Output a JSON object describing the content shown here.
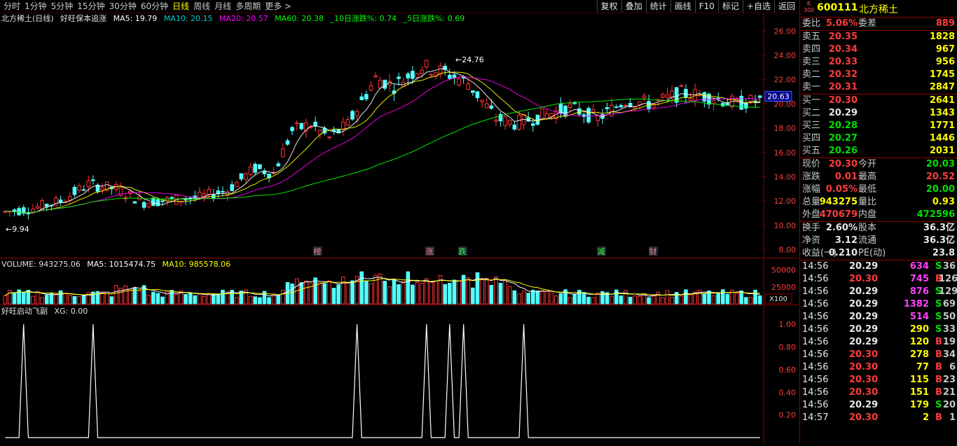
{
  "toolbar": {
    "periods": [
      "分时",
      "1分钟",
      "5分钟",
      "15分钟",
      "30分钟",
      "60分钟",
      "日线",
      "周线",
      "月线",
      "多周期",
      "更多 >"
    ],
    "active": "日线",
    "buttons": [
      "复权",
      "叠加",
      "统计",
      "画线",
      "F10",
      "标记",
      "+自选",
      "返回"
    ]
  },
  "main_legend": {
    "title": "北方稀土(日线)",
    "indicator": "好旺保本追涨",
    "ma5": "MA5: 19.79",
    "ma10": "MA10: 20.15",
    "ma20": "MA20: 20.57",
    "ma60": "MA60: 20.38",
    "chg10": "_10日涨跌%: 0.74",
    "chg5": "_5日涨跌%: 0.69"
  },
  "volume_legend": {
    "label": "VOLUME: 943275.06",
    "ma5": "MA5: 1015474.75",
    "ma10": "MA10: 985578.06"
  },
  "indicator_legend": {
    "label": "好旺启动飞副",
    "xg": "XG: 0.00"
  },
  "annotations": {
    "high": "24.76",
    "low": "9.94",
    "current": "20.63",
    "markers": [
      "榜",
      "涨",
      "跌",
      "减",
      "财"
    ],
    "vol_unit": "X100"
  },
  "chart_data": [
    {
      "type": "candlestick",
      "name": "main",
      "ylim": [
        7.4,
        27
      ],
      "y_ticks": [
        8.0,
        10.0,
        12.0,
        14.0,
        16.0,
        18.0,
        20.0,
        22.0,
        24.0,
        26.0
      ],
      "colors": {
        "up": "#ff3232",
        "down": "#54ffff",
        "ma5": "#ffffff",
        "ma10": "#ffff00",
        "ma20": "#ff00ff",
        "ma60": "#00ff00"
      }
    },
    {
      "type": "bar",
      "name": "volume",
      "ylim": [
        0,
        62000
      ],
      "y_ticks": [
        25000,
        50000
      ]
    },
    {
      "type": "line",
      "name": "indicator",
      "ylim": [
        0,
        1.1
      ],
      "y_ticks": [
        0.2,
        0.4,
        0.6,
        0.8,
        1.0
      ],
      "spike_index": [
        4,
        19,
        76,
        91,
        96,
        99,
        112
      ]
    }
  ],
  "quote": {
    "code": "600111",
    "name": "北方稀土",
    "r300": "R\n300",
    "weibi_lbl": "委比",
    "weibi": "5.06%",
    "weicha_lbl": "委差",
    "weicha": "889",
    "asks": [
      {
        "label": "卖五",
        "price": "20.35",
        "vol": "1828"
      },
      {
        "label": "卖四",
        "price": "20.34",
        "vol": "967"
      },
      {
        "label": "卖三",
        "price": "20.33",
        "vol": "956"
      },
      {
        "label": "卖二",
        "price": "20.32",
        "vol": "1745"
      },
      {
        "label": "卖一",
        "price": "20.31",
        "vol": "2847"
      }
    ],
    "bids": [
      {
        "label": "买一",
        "price": "20.30",
        "vol": "2641",
        "pc": "red"
      },
      {
        "label": "买二",
        "price": "20.29",
        "vol": "1343",
        "pc": "white"
      },
      {
        "label": "买三",
        "price": "20.28",
        "vol": "1771",
        "pc": "green"
      },
      {
        "label": "买四",
        "price": "20.27",
        "vol": "1446",
        "pc": "green"
      },
      {
        "label": "买五",
        "price": "20.26",
        "vol": "2031",
        "pc": "green"
      }
    ],
    "stats": [
      {
        "l1": "现价",
        "v1": "20.30",
        "c1": "red",
        "l2": "今开",
        "v2": "20.03",
        "c2": "green"
      },
      {
        "l1": "涨跌",
        "v1": "0.01",
        "c1": "red",
        "l2": "最高",
        "v2": "20.52",
        "c2": "red"
      },
      {
        "l1": "涨幅",
        "v1": "0.05%",
        "c1": "red",
        "l2": "最低",
        "v2": "20.00",
        "c2": "green"
      },
      {
        "l1": "总量",
        "v1": "943275",
        "c1": "yellow",
        "l2": "量比",
        "v2": "0.93",
        "c2": "yellow"
      },
      {
        "l1": "外盘",
        "v1": "470679",
        "c1": "red",
        "l2": "内盘",
        "v2": "472596",
        "c2": "green"
      }
    ],
    "stats2": [
      {
        "l1": "换手",
        "v1": "2.60%",
        "l2": "股本",
        "v2": "36.3亿"
      },
      {
        "l1": "净资",
        "v1": "3.12",
        "l2": "流通",
        "v2": "36.3亿"
      },
      {
        "l1": "收益(一)",
        "v1": "0.210",
        "l2": "PE(动)",
        "v2": "23.8"
      }
    ],
    "trades": [
      {
        "t": "14:56",
        "p": "20.29",
        "pc": "white",
        "q": "634",
        "qc": "purple",
        "s": "S",
        "n": "36"
      },
      {
        "t": "14:56",
        "p": "20.30",
        "pc": "red",
        "q": "745",
        "qc": "purple",
        "s": "B",
        "n": "126"
      },
      {
        "t": "14:56",
        "p": "20.29",
        "pc": "white",
        "q": "876",
        "qc": "purple",
        "s": "S",
        "n": "129"
      },
      {
        "t": "14:56",
        "p": "20.29",
        "pc": "white",
        "q": "1382",
        "qc": "purple",
        "s": "S",
        "n": "69"
      },
      {
        "t": "14:56",
        "p": "20.29",
        "pc": "white",
        "q": "514",
        "qc": "purple",
        "s": "S",
        "n": "50"
      },
      {
        "t": "14:56",
        "p": "20.29",
        "pc": "white",
        "q": "290",
        "qc": "yellow",
        "s": "S",
        "n": "33"
      },
      {
        "t": "14:56",
        "p": "20.29",
        "pc": "white",
        "q": "120",
        "qc": "yellow",
        "s": "B",
        "n": "19"
      },
      {
        "t": "14:56",
        "p": "20.30",
        "pc": "red",
        "q": "278",
        "qc": "yellow",
        "s": "B",
        "n": "34"
      },
      {
        "t": "14:56",
        "p": "20.30",
        "pc": "red",
        "q": "77",
        "qc": "yellow",
        "s": "B",
        "n": "6"
      },
      {
        "t": "14:56",
        "p": "20.30",
        "pc": "red",
        "q": "115",
        "qc": "yellow",
        "s": "B",
        "n": "23"
      },
      {
        "t": "14:56",
        "p": "20.30",
        "pc": "red",
        "q": "151",
        "qc": "yellow",
        "s": "B",
        "n": "21"
      },
      {
        "t": "14:56",
        "p": "20.29",
        "pc": "white",
        "q": "179",
        "qc": "yellow",
        "s": "S",
        "n": "20"
      },
      {
        "t": "14:57",
        "p": "20.30",
        "pc": "red",
        "q": "2",
        "qc": "yellow",
        "s": "B",
        "n": "1"
      }
    ]
  }
}
